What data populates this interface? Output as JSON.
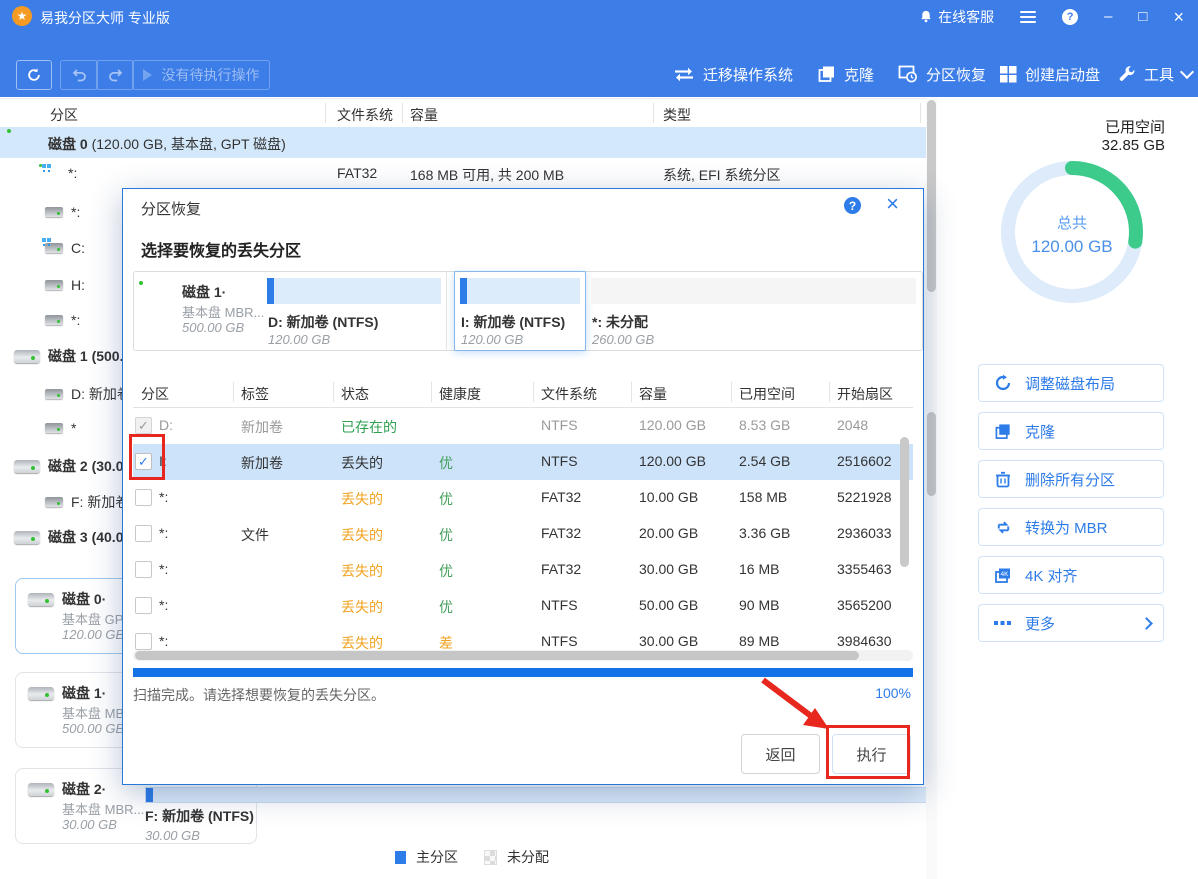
{
  "titlebar": {
    "app_title": "易我分区大师 专业版",
    "online_service": "在线客服",
    "minimize": "–",
    "maximize": "□",
    "close": "×"
  },
  "toolbar": {
    "pending": "没有待执行操作",
    "migrate": "迁移操作系统",
    "clone": "克隆",
    "recover": "分区恢复",
    "boot_disk": "创建启动盘",
    "tools": "工具"
  },
  "main_table": {
    "columns": [
      "分区",
      "文件系统",
      "容量",
      "类型"
    ],
    "disk0": {
      "name": "磁盘 0",
      "info": "(120.00 GB, 基本盘, GPT 磁盘)"
    },
    "efi_row": {
      "partition": "*:",
      "fs": "FAT32",
      "capacity": "168 MB   可用, 共   200 MB",
      "type": "系统, EFI 系统分区"
    }
  },
  "tree": {
    "items": [
      {
        "label": "*:"
      },
      {
        "label": "C:"
      },
      {
        "label": "H:"
      },
      {
        "label": "*:"
      },
      {
        "label": "磁盘 1 (500."
      },
      {
        "label": "D: 新加卷"
      },
      {
        "label": "*"
      },
      {
        "label": "磁盘 2 (30.0"
      },
      {
        "label": "F: 新加卷"
      },
      {
        "label": "磁盘 3 (40.0"
      }
    ]
  },
  "disk_cards": [
    {
      "name": "磁盘 0·",
      "type": "基本盘 GPT .",
      "size": "120.00 GB"
    },
    {
      "name": "磁盘 1·",
      "type": "基本盘 MBR.",
      "size": "500.00 GB"
    },
    {
      "name": "磁盘 2·",
      "type": "基本盘 MBR...",
      "size": "30.00 GB"
    }
  ],
  "bottom_strip": {
    "label": "F: 新加卷 (NTFS)",
    "size": "30.00 GB"
  },
  "legend": {
    "primary": "主分区",
    "unallocated": "未分配"
  },
  "sidebar": {
    "used_label": "已用空间",
    "used_value": "32.85 GB",
    "total_label": "总共",
    "total_value": "120.00 GB",
    "used_percent": 27.4,
    "buttons": [
      {
        "label": "调整磁盘布局"
      },
      {
        "label": "克隆"
      },
      {
        "label": "删除所有分区"
      },
      {
        "label": "转换为 MBR"
      },
      {
        "label": "4K 对齐"
      },
      {
        "label": "更多"
      }
    ]
  },
  "dialog": {
    "title": "分区恢复",
    "subtitle": "选择要恢复的丢失分区",
    "disk_strip": {
      "disk": {
        "name": "磁盘 1·",
        "type": "基本盘 MBR...",
        "size": "500.00 GB"
      },
      "segments": [
        {
          "label": "D: 新加卷 (NTFS)",
          "size": "120.00 GB"
        },
        {
          "label": "I: 新加卷 (NTFS)",
          "size": "120.00 GB"
        },
        {
          "label": "*: 未分配",
          "size": "260.00 GB"
        }
      ]
    },
    "table": {
      "columns": [
        "分区",
        "标签",
        "状态",
        "健康度",
        "文件系统",
        "容量",
        "已用空间",
        "开始扇区"
      ],
      "rows": [
        {
          "partition": "D:",
          "label": "新加卷",
          "status": "已存在的",
          "health": "",
          "fs": "NTFS",
          "capacity": "120.00 GB",
          "used": "8.53 GB",
          "sector": "2048",
          "checked": "gray",
          "dim": true,
          "status_color": "green",
          "health_color": "green"
        },
        {
          "partition": "I:",
          "label": "新加卷",
          "status": "丢失的",
          "health": "优",
          "fs": "NTFS",
          "capacity": "120.00 GB",
          "used": "2.54 GB",
          "sector": "2516602",
          "checked": "blue",
          "selected": true,
          "status_color": "dark",
          "health_color": "green"
        },
        {
          "partition": "*:",
          "label": "",
          "status": "丢失的",
          "health": "优",
          "fs": "FAT32",
          "capacity": "10.00 GB",
          "used": "158 MB",
          "sector": "5221928",
          "status_color": "orange",
          "health_color": "green"
        },
        {
          "partition": "*:",
          "label": "文件",
          "status": "丢失的",
          "health": "优",
          "fs": "FAT32",
          "capacity": "20.00 GB",
          "used": "3.36 GB",
          "sector": "2936033",
          "status_color": "orange",
          "health_color": "green"
        },
        {
          "partition": "*:",
          "label": "",
          "status": "丢失的",
          "health": "优",
          "fs": "FAT32",
          "capacity": "30.00 GB",
          "used": "16 MB",
          "sector": "3355463",
          "status_color": "orange",
          "health_color": "green"
        },
        {
          "partition": "*:",
          "label": "",
          "status": "丢失的",
          "health": "优",
          "fs": "NTFS",
          "capacity": "50.00 GB",
          "used": "90 MB",
          "sector": "3565200",
          "status_color": "orange",
          "health_color": "green"
        },
        {
          "partition": "*:",
          "label": "",
          "status": "丢失的",
          "health": "差",
          "fs": "NTFS",
          "capacity": "30.00 GB",
          "used": "89 MB",
          "sector": "3984630",
          "status_color": "orange",
          "health_color": "orange"
        }
      ]
    },
    "progress": {
      "status_text": "扫描完成。请选择想要恢复的丢失分区。",
      "percent": "100%"
    },
    "back_button": "返回",
    "execute_button": "执行"
  },
  "colors": {
    "titlebar_blue": "#3c7de8",
    "accent_blue": "#2d7ce8",
    "green": "#2fa052",
    "orange": "#f0a321",
    "annotation_red": "#e8281e",
    "row_highlight": "#cce3fa",
    "donut_green": "#3ccb8a"
  }
}
